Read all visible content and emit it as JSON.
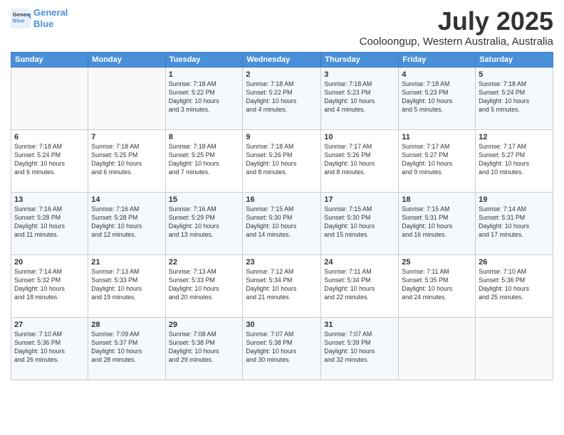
{
  "header": {
    "logo_line1": "General",
    "logo_line2": "Blue",
    "title": "July 2025",
    "subtitle": "Cooloongup, Western Australia, Australia"
  },
  "calendar": {
    "days_of_week": [
      "Sunday",
      "Monday",
      "Tuesday",
      "Wednesday",
      "Thursday",
      "Friday",
      "Saturday"
    ],
    "weeks": [
      [
        {
          "day": "",
          "detail": ""
        },
        {
          "day": "",
          "detail": ""
        },
        {
          "day": "1",
          "detail": "Sunrise: 7:18 AM\nSunset: 5:22 PM\nDaylight: 10 hours\nand 3 minutes."
        },
        {
          "day": "2",
          "detail": "Sunrise: 7:18 AM\nSunset: 5:22 PM\nDaylight: 10 hours\nand 4 minutes."
        },
        {
          "day": "3",
          "detail": "Sunrise: 7:18 AM\nSunset: 5:23 PM\nDaylight: 10 hours\nand 4 minutes."
        },
        {
          "day": "4",
          "detail": "Sunrise: 7:18 AM\nSunset: 5:23 PM\nDaylight: 10 hours\nand 5 minutes."
        },
        {
          "day": "5",
          "detail": "Sunrise: 7:18 AM\nSunset: 5:24 PM\nDaylight: 10 hours\nand 5 minutes."
        }
      ],
      [
        {
          "day": "6",
          "detail": "Sunrise: 7:18 AM\nSunset: 5:24 PM\nDaylight: 10 hours\nand 6 minutes."
        },
        {
          "day": "7",
          "detail": "Sunrise: 7:18 AM\nSunset: 5:25 PM\nDaylight: 10 hours\nand 6 minutes."
        },
        {
          "day": "8",
          "detail": "Sunrise: 7:18 AM\nSunset: 5:25 PM\nDaylight: 10 hours\nand 7 minutes."
        },
        {
          "day": "9",
          "detail": "Sunrise: 7:18 AM\nSunset: 5:26 PM\nDaylight: 10 hours\nand 8 minutes."
        },
        {
          "day": "10",
          "detail": "Sunrise: 7:17 AM\nSunset: 5:26 PM\nDaylight: 10 hours\nand 8 minutes."
        },
        {
          "day": "11",
          "detail": "Sunrise: 7:17 AM\nSunset: 5:27 PM\nDaylight: 10 hours\nand 9 minutes."
        },
        {
          "day": "12",
          "detail": "Sunrise: 7:17 AM\nSunset: 5:27 PM\nDaylight: 10 hours\nand 10 minutes."
        }
      ],
      [
        {
          "day": "13",
          "detail": "Sunrise: 7:16 AM\nSunset: 5:28 PM\nDaylight: 10 hours\nand 11 minutes."
        },
        {
          "day": "14",
          "detail": "Sunrise: 7:16 AM\nSunset: 5:28 PM\nDaylight: 10 hours\nand 12 minutes."
        },
        {
          "day": "15",
          "detail": "Sunrise: 7:16 AM\nSunset: 5:29 PM\nDaylight: 10 hours\nand 13 minutes."
        },
        {
          "day": "16",
          "detail": "Sunrise: 7:15 AM\nSunset: 5:30 PM\nDaylight: 10 hours\nand 14 minutes."
        },
        {
          "day": "17",
          "detail": "Sunrise: 7:15 AM\nSunset: 5:30 PM\nDaylight: 10 hours\nand 15 minutes."
        },
        {
          "day": "18",
          "detail": "Sunrise: 7:15 AM\nSunset: 5:31 PM\nDaylight: 10 hours\nand 16 minutes."
        },
        {
          "day": "19",
          "detail": "Sunrise: 7:14 AM\nSunset: 5:31 PM\nDaylight: 10 hours\nand 17 minutes."
        }
      ],
      [
        {
          "day": "20",
          "detail": "Sunrise: 7:14 AM\nSunset: 5:32 PM\nDaylight: 10 hours\nand 18 minutes."
        },
        {
          "day": "21",
          "detail": "Sunrise: 7:13 AM\nSunset: 5:33 PM\nDaylight: 10 hours\nand 19 minutes."
        },
        {
          "day": "22",
          "detail": "Sunrise: 7:13 AM\nSunset: 5:33 PM\nDaylight: 10 hours\nand 20 minutes."
        },
        {
          "day": "23",
          "detail": "Sunrise: 7:12 AM\nSunset: 5:34 PM\nDaylight: 10 hours\nand 21 minutes."
        },
        {
          "day": "24",
          "detail": "Sunrise: 7:11 AM\nSunset: 5:34 PM\nDaylight: 10 hours\nand 22 minutes."
        },
        {
          "day": "25",
          "detail": "Sunrise: 7:11 AM\nSunset: 5:35 PM\nDaylight: 10 hours\nand 24 minutes."
        },
        {
          "day": "26",
          "detail": "Sunrise: 7:10 AM\nSunset: 5:36 PM\nDaylight: 10 hours\nand 25 minutes."
        }
      ],
      [
        {
          "day": "27",
          "detail": "Sunrise: 7:10 AM\nSunset: 5:36 PM\nDaylight: 10 hours\nand 26 minutes."
        },
        {
          "day": "28",
          "detail": "Sunrise: 7:09 AM\nSunset: 5:37 PM\nDaylight: 10 hours\nand 28 minutes."
        },
        {
          "day": "29",
          "detail": "Sunrise: 7:08 AM\nSunset: 5:38 PM\nDaylight: 10 hours\nand 29 minutes."
        },
        {
          "day": "30",
          "detail": "Sunrise: 7:07 AM\nSunset: 5:38 PM\nDaylight: 10 hours\nand 30 minutes."
        },
        {
          "day": "31",
          "detail": "Sunrise: 7:07 AM\nSunset: 5:39 PM\nDaylight: 10 hours\nand 32 minutes."
        },
        {
          "day": "",
          "detail": ""
        },
        {
          "day": "",
          "detail": ""
        }
      ]
    ]
  }
}
